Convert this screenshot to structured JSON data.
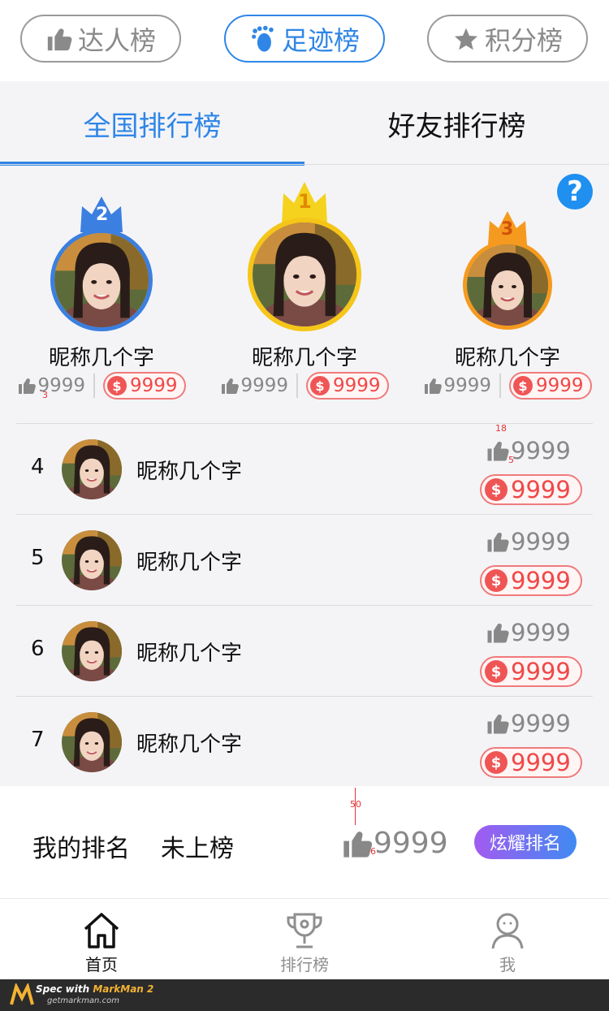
{
  "top_tabs": [
    {
      "label": "达人榜",
      "icon": "thumb-up-icon",
      "active": false
    },
    {
      "label": "足迹榜",
      "icon": "footprint-icon",
      "active": true
    },
    {
      "label": "积分榜",
      "icon": "star-icon",
      "active": false
    }
  ],
  "sub_tabs": [
    {
      "label": "全国排行榜",
      "active": true
    },
    {
      "label": "好友排行榜",
      "active": false
    }
  ],
  "help": {
    "icon": "help-icon",
    "symbol": "?"
  },
  "podium": [
    {
      "rank": "2",
      "name": "昵称几个字",
      "likes": "9999",
      "coins": "9999",
      "color": "#3b7fe0"
    },
    {
      "rank": "1",
      "name": "昵称几个字",
      "likes": "9999",
      "coins": "9999",
      "color": "#f5c518"
    },
    {
      "rank": "3",
      "name": "昵称几个字",
      "likes": "9999",
      "coins": "9999",
      "color": "#f59a1e"
    }
  ],
  "list": [
    {
      "rank": "4",
      "name": "昵称几个字",
      "likes": "9999",
      "coins": "9999"
    },
    {
      "rank": "5",
      "name": "昵称几个字",
      "likes": "9999",
      "coins": "9999"
    },
    {
      "rank": "6",
      "name": "昵称几个字",
      "likes": "9999",
      "coins": "9999"
    },
    {
      "rank": "7",
      "name": "昵称几个字",
      "likes": "9999",
      "coins": "9999"
    }
  ],
  "coin_symbol": "$",
  "my_rank": {
    "label": "我的排名",
    "status": "未上榜",
    "likes": "9999",
    "button": "炫耀排名"
  },
  "bottom_nav": [
    {
      "label": "首页",
      "icon": "home-icon",
      "active": true
    },
    {
      "label": "排行榜",
      "icon": "trophy-icon",
      "active": false
    },
    {
      "label": "我",
      "icon": "user-icon",
      "active": false
    }
  ],
  "footer": {
    "brand_prefix": "Spec with ",
    "brand": "MarkMan 2",
    "url": "getmarkman.com"
  },
  "spec_marks": [
    "3",
    "18",
    "5",
    "50",
    "6"
  ],
  "colors": {
    "accent": "#2f86e6",
    "coin": "#f05555",
    "gold": "#f5c518",
    "silver_blue": "#3b7fe0",
    "bronze": "#f59a1e"
  }
}
